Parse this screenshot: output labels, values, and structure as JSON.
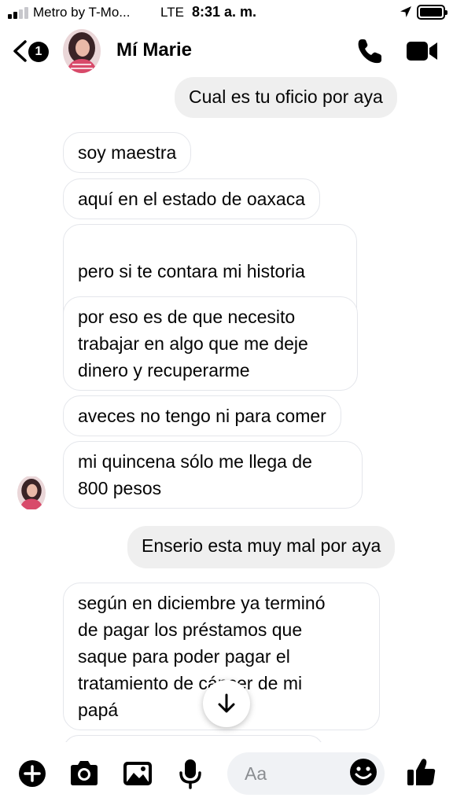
{
  "status_bar": {
    "carrier": "Metro by T-Mo...",
    "network": "LTE",
    "time": "8:31 a. m."
  },
  "header": {
    "unread_count": "1",
    "contact_name": "Mí Marie"
  },
  "messages": [
    {
      "direction": "out",
      "text": "Cual es tu oficio por aya"
    },
    {
      "direction": "in",
      "text": "soy maestra"
    },
    {
      "direction": "in",
      "text": "aquí en el estado de oaxaca"
    },
    {
      "direction": "in",
      "text": "pero si te contara mi historia",
      "emoji": "😞"
    },
    {
      "direction": "in",
      "text": "por eso es de que necesito\ntrabajar en algo que me deje\ndinero y recuperarme"
    },
    {
      "direction": "in",
      "text": "aveces no tengo ni para comer"
    },
    {
      "direction": "in",
      "text": "mi quincena sólo me llega de\n800 pesos"
    },
    {
      "direction": "out",
      "text": "Enserio esta muy mal por aya"
    },
    {
      "direction": "in",
      "text": "según en diciembre ya terminó\nde pagar los préstamos que\nsaque para poder pagar el\ntratamiento de cáncer de mi\npapá"
    }
  ],
  "composer": {
    "placeholder": "Aa"
  },
  "icons": {
    "signal": "signal-bars-icon",
    "location": "location-arrow-icon",
    "battery": "battery-icon",
    "back": "chevron-left-icon",
    "call": "phone-icon",
    "video": "video-camera-icon",
    "scroll_down": "arrow-down-icon",
    "add": "plus-circle-icon",
    "camera": "camera-icon",
    "gallery": "image-icon",
    "mic": "microphone-icon",
    "emoji": "smiley-icon",
    "like": "thumbs-up-icon"
  },
  "colors": {
    "incoming_bubble_border": "#e4e6eb",
    "outgoing_bubble": "#efefef",
    "input_background": "#f0f2f5"
  }
}
